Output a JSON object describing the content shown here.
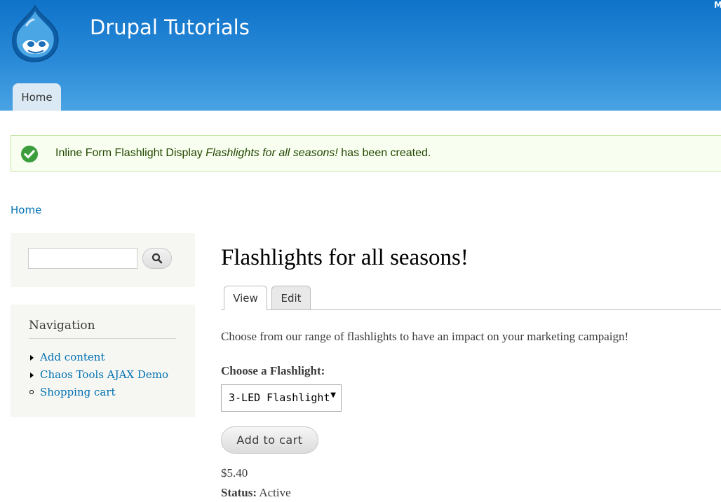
{
  "header": {
    "site_name": "Drupal Tutorials",
    "corner_text": "M",
    "main_menu": [
      {
        "label": "Home"
      }
    ],
    "logo_icon": "drupal-drop-icon"
  },
  "messages": {
    "status": {
      "prefix": "Inline Form Flashlight Display ",
      "title": "Flashlights for all seasons!",
      "suffix": " has been created.",
      "icon": "check-circle-icon",
      "icon_color": "#3b9d3b"
    }
  },
  "breadcrumb": {
    "home": "Home"
  },
  "sidebar": {
    "search": {
      "value": "",
      "button_icon": "search-icon"
    },
    "navigation": {
      "title": "Navigation",
      "items": [
        {
          "label": "Add content",
          "bullet": "collapsed-triangle"
        },
        {
          "label": "Chaos Tools AJAX Demo",
          "bullet": "collapsed-triangle"
        },
        {
          "label": "Shopping cart",
          "bullet": "leaf-circle"
        }
      ]
    }
  },
  "main": {
    "title": "Flashlights for all seasons!",
    "tabs": [
      {
        "label": "View",
        "active": true
      },
      {
        "label": "Edit",
        "active": false
      }
    ],
    "body": "Choose from our range of flashlights to have an impact on your marketing campaign!",
    "choose_label": "Choose a Flashlight:",
    "select": {
      "selected": "3-LED Flashlight"
    },
    "add_to_cart": "Add to cart",
    "price": "$5.40",
    "status_label": "Status:",
    "status_value": "Active"
  },
  "colors": {
    "header_top": "#0f73c9",
    "header_bottom": "#4aa3e3",
    "link": "#0071b3",
    "message_bg": "#f8fff0",
    "message_border": "#c5e6a6"
  }
}
